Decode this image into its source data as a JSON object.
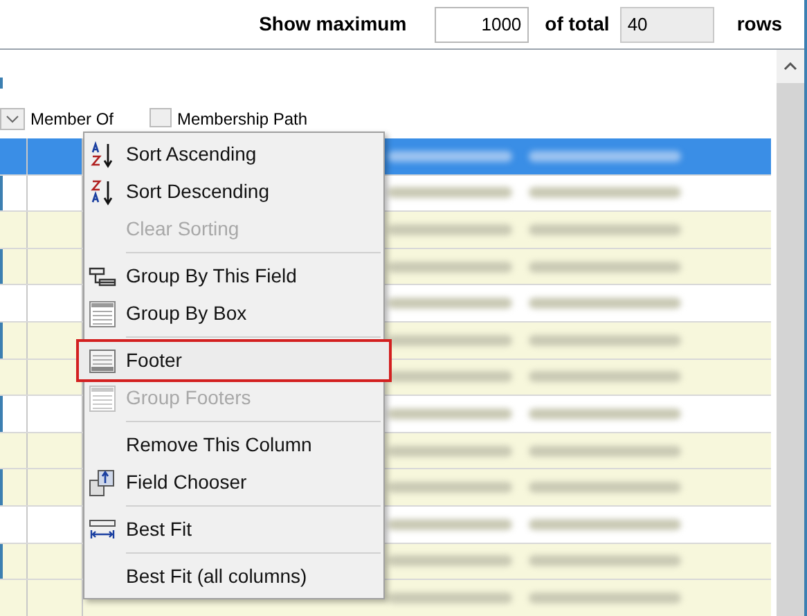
{
  "toolbar": {
    "show_maximum_label": "Show maximum",
    "maximum_value": "1000",
    "of_total_label": "of total",
    "total_value": "40",
    "rows_label": "rows"
  },
  "grid": {
    "columns": [
      {
        "label": "Member Of"
      },
      {
        "label": "Membership Path",
        "checked": false
      }
    ],
    "rows": [
      {
        "selected": true
      },
      {
        "selected": false
      },
      {
        "selected": false
      },
      {
        "selected": false
      },
      {
        "selected": false
      },
      {
        "selected": false
      },
      {
        "selected": false
      },
      {
        "selected": false
      },
      {
        "selected": false
      },
      {
        "selected": false
      },
      {
        "selected": false
      },
      {
        "selected": false
      },
      {
        "selected": false
      }
    ]
  },
  "context_menu": {
    "items": [
      {
        "kind": "item",
        "label": "Sort Ascending",
        "disabled": false,
        "highlighted": false
      },
      {
        "kind": "item",
        "label": "Sort Descending",
        "disabled": false,
        "highlighted": false
      },
      {
        "kind": "item",
        "label": "Clear Sorting",
        "disabled": true,
        "highlighted": false
      },
      {
        "kind": "separator"
      },
      {
        "kind": "item",
        "label": "Group By This Field",
        "disabled": false,
        "highlighted": false
      },
      {
        "kind": "item",
        "label": "Group By Box",
        "disabled": false,
        "highlighted": false
      },
      {
        "kind": "separator"
      },
      {
        "kind": "item",
        "label": "Footer",
        "disabled": false,
        "highlighted": true
      },
      {
        "kind": "item",
        "label": "Group Footers",
        "disabled": true,
        "highlighted": false
      },
      {
        "kind": "separator"
      },
      {
        "kind": "item",
        "label": "Remove This Column",
        "disabled": false,
        "highlighted": false
      },
      {
        "kind": "item",
        "label": "Field Chooser",
        "disabled": false,
        "highlighted": false
      },
      {
        "kind": "separator"
      },
      {
        "kind": "item",
        "label": "Best Fit",
        "disabled": false,
        "highlighted": false
      },
      {
        "kind": "separator"
      },
      {
        "kind": "item",
        "label": "Best Fit (all columns)",
        "disabled": false,
        "highlighted": false
      }
    ]
  }
}
